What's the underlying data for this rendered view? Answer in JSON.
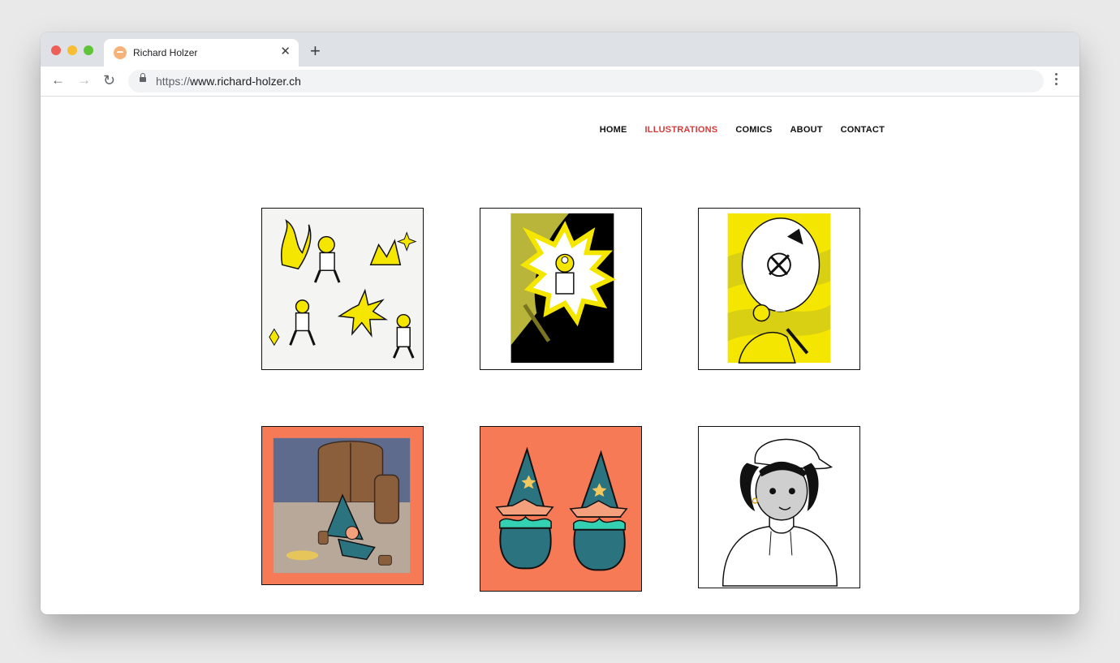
{
  "browser": {
    "tab_title": "Richard Holzer",
    "new_tab_symbol": "+",
    "close_symbol": "✕",
    "url_scheme": "https://",
    "url_host": "www.richard-holzer.ch",
    "icons": [
      "back-arrow-icon",
      "forward-arrow-icon",
      "reload-icon",
      "lock-icon",
      "kebab-menu-icon",
      "favicon-icon"
    ]
  },
  "nav": {
    "home": "HOME",
    "illustrations": "ILLUSTRATIONS",
    "comics": "COMICS",
    "about": "ABOUT",
    "contact": "CONTACT",
    "active": "ILLUSTRATIONS",
    "active_color": "#d63c3c"
  },
  "gallery": {
    "items": [
      "miners-sticker-sheet",
      "miner-in-cave-explosion",
      "miner-falling-bubble",
      "wizard-in-cellar",
      "two-wizard-hats",
      "girl-in-cap-hoodie"
    ],
    "accent_yellow": "#f5e600",
    "accent_orange": "#f57a55",
    "accent_teal": "#2c7380"
  }
}
